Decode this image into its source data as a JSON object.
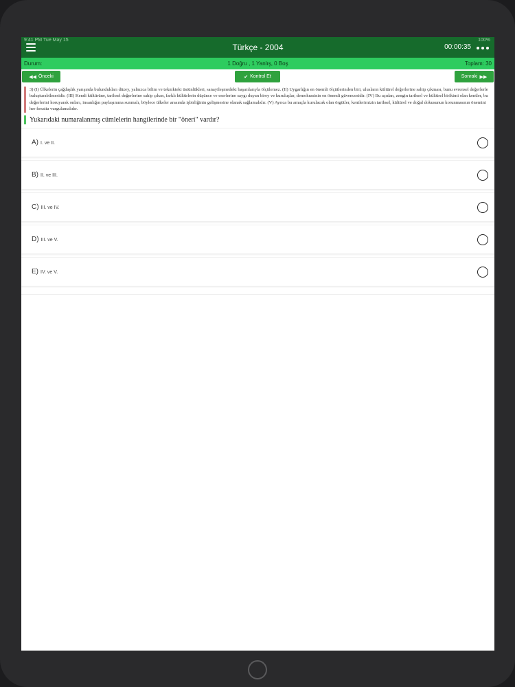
{
  "status": {
    "time": "9:41 PM",
    "date": "Tue May 15",
    "battery": "100%"
  },
  "header": {
    "title": "Türkçe - 2004",
    "timer": "00:00:35"
  },
  "summary": {
    "label": "Durum:",
    "score": "1 Doğru , 1 Yanlış, 0 Boş",
    "total": "Toplam: 30"
  },
  "toolbar": {
    "prev_label": "Önceki",
    "check_label": "Kontrol Et",
    "next_label": "Sonraki"
  },
  "question": {
    "passage": "3) (I) Ülkelerin çağdaşlık yarışında bulundukları düzey, yalnızca bilim ve teknikteki üstünlükleri, sanayileşmedeki başarılarıyla ölçülemez. (II) Uygarlığın en önemli ölçütlerinden biri, ulusların kültürel değerlerine sahip çıkması, bunu evrensel değerlerle buluşturabilmesidir. (III) Kendi kültürüne, tarihsel değerlerine sahip çıkan, farklı kültürlerin düşünce ve eserlerine saygı duyan birey ve kuruluşlar, demokrasinin en önemli güvencesidir. (IV) Bu açıdan, zengin tarihsel ve kültürel birikimi olan kentler, bu değerlerini koruyarak onları, insanlığın paylaşımına sunmalı, böylece ülkeler arasında işbirliğinin gelişmesine olanak sağlamalıdır. (V) Ayrıca bu amaçla kurulacak olan örgütler, kentlerimizin tarihsel, kültürel ve doğal dokusunun korunmasının önemini her fırsatta vurgulamalıdır.",
    "prompt": "Yukarıdaki numaralanmış cümlelerin hangilerinde bir \"öneri\" vardır?",
    "options": [
      {
        "letter": "A)",
        "text": "I. ve II."
      },
      {
        "letter": "B)",
        "text": "II. ve III."
      },
      {
        "letter": "C)",
        "text": "III. ve IV."
      },
      {
        "letter": "D)",
        "text": "III. ve V."
      },
      {
        "letter": "E)",
        "text": "IV. ve V."
      }
    ]
  }
}
